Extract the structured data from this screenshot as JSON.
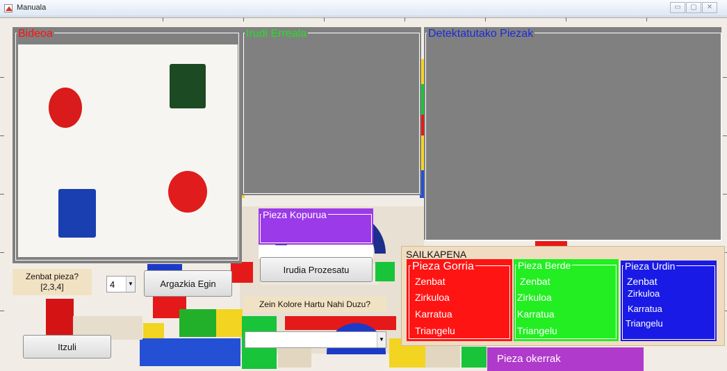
{
  "window": {
    "title": "Manuala",
    "controls": [
      "▭",
      "▢",
      "✕"
    ]
  },
  "panels": {
    "video": {
      "title": "Bideoa",
      "title_color": "#ff1010"
    },
    "real_image": {
      "title": "Irudi Erreala",
      "title_color": "#22e022"
    },
    "detected": {
      "title": "Detektatutako Piezak",
      "title_color": "#1a2bd8"
    }
  },
  "piece_count_panel": {
    "title": "Pieza Kopurua"
  },
  "controls": {
    "how_many_label": "Zenbat pieza?\n[2,3,4]",
    "count_select_value": "4",
    "capture_button": "Argazkia Egin",
    "process_button": "Irudia Prozesatu",
    "color_question": "Zein Kolore Hartu Nahi Duzu?",
    "color_select_value": "",
    "back_button": "Itzuli",
    "wrong_pieces": "Pieza okerrak"
  },
  "classification": {
    "title": "SAILKAPENA",
    "groups": [
      {
        "title": "Pieza Gorria",
        "color": "#ff1414",
        "items": [
          "Zenbat",
          "Zirkuloa",
          "Karratua",
          "Triangelu"
        ]
      },
      {
        "title": "Pieza Berde",
        "color": "#22ee22",
        "items": [
          "Zenbat",
          "Zirkuloa",
          "Karratua",
          "Triangelu"
        ]
      },
      {
        "title": "Pieza Urdin",
        "color": "#1a1ae6",
        "items": [
          "Zenbat",
          "Zirkuloa",
          "Karratua",
          "Triangelu"
        ]
      }
    ]
  },
  "colors": {
    "panel_gray": "#808080",
    "purple": "#9b3ae8",
    "wrong_purple": "#b03acb",
    "classification_bg": "#f0dcc0"
  }
}
